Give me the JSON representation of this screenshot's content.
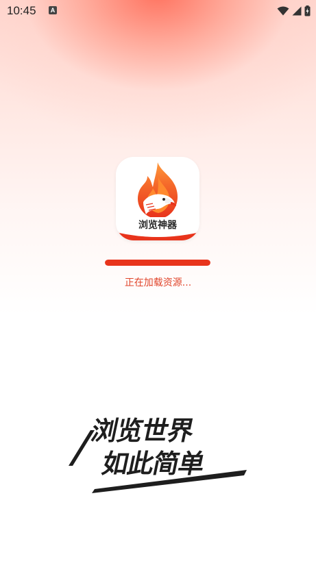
{
  "status_bar": {
    "time": "10:45",
    "notification_icon": "a-letter-icon",
    "icons": [
      "wifi-icon",
      "signal-icon",
      "battery-icon"
    ]
  },
  "app": {
    "logo_text": "浏览神器",
    "loading_text": "正在加载资源...",
    "progress_percent": 100,
    "slogan_line1": "浏览世界",
    "slogan_line2": "如此简单"
  },
  "colors": {
    "accent": "#e8341c",
    "loading_text": "#e0442a",
    "slogan": "#1e1e1e"
  }
}
